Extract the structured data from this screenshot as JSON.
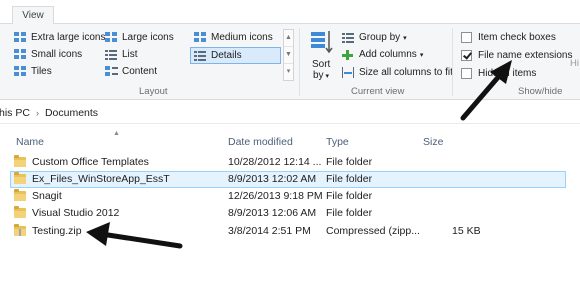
{
  "ribbon": {
    "tab": "View",
    "layout": {
      "items": [
        "Extra large icons",
        "Large icons",
        "Medium icons",
        "Small icons",
        "List",
        "Details",
        "Tiles",
        "Content"
      ],
      "group_label": "Layout"
    },
    "current_view": {
      "sort_by_line1": "Sort",
      "sort_by_line2": "by",
      "group_by": "Group by",
      "add_columns": "Add columns",
      "size_columns": "Size all columns to fit",
      "group_label": "Current view"
    },
    "show_hide": {
      "item_checkboxes": {
        "label": "Item check boxes",
        "checked": false
      },
      "file_name_extensions": {
        "label": "File name extensions",
        "checked": true
      },
      "hidden_items": {
        "label": "Hidden items",
        "checked": false
      },
      "group_label": "Show/hide",
      "overflow_text": "Hi"
    }
  },
  "address": {
    "crumbs": [
      "his PC",
      "Documents"
    ]
  },
  "columns": {
    "name": "Name",
    "date_modified": "Date modified",
    "type": "Type",
    "size": "Size"
  },
  "files": [
    {
      "name": "Custom Office Templates",
      "date": "10/28/2012 12:14 ...",
      "type": "File folder",
      "size": "",
      "icon": "folder-icon",
      "selected": false
    },
    {
      "name": "Ex_Files_WinStoreApp_EssT",
      "date": "8/9/2013 12:02 AM",
      "type": "File folder",
      "size": "",
      "icon": "folder-icon",
      "selected": true
    },
    {
      "name": "Snagit",
      "date": "12/26/2013 9:18 PM",
      "type": "File folder",
      "size": "",
      "icon": "folder-icon",
      "selected": false
    },
    {
      "name": "Visual Studio 2012",
      "date": "8/9/2013 12:06 AM",
      "type": "File folder",
      "size": "",
      "icon": "folder-icon",
      "selected": false
    },
    {
      "name": "Testing.zip",
      "date": "3/8/2014 2:51 PM",
      "type": "Compressed (zipp...",
      "size": "15 KB",
      "icon": "zip-folder-icon",
      "selected": false
    }
  ],
  "colors": {
    "selection_bg": "#e5f3ff",
    "selection_border": "#99d1ff",
    "ribbon_bg": "#f5f6f7",
    "header_text": "#4c607a",
    "annotation_arrow": "#111111"
  }
}
